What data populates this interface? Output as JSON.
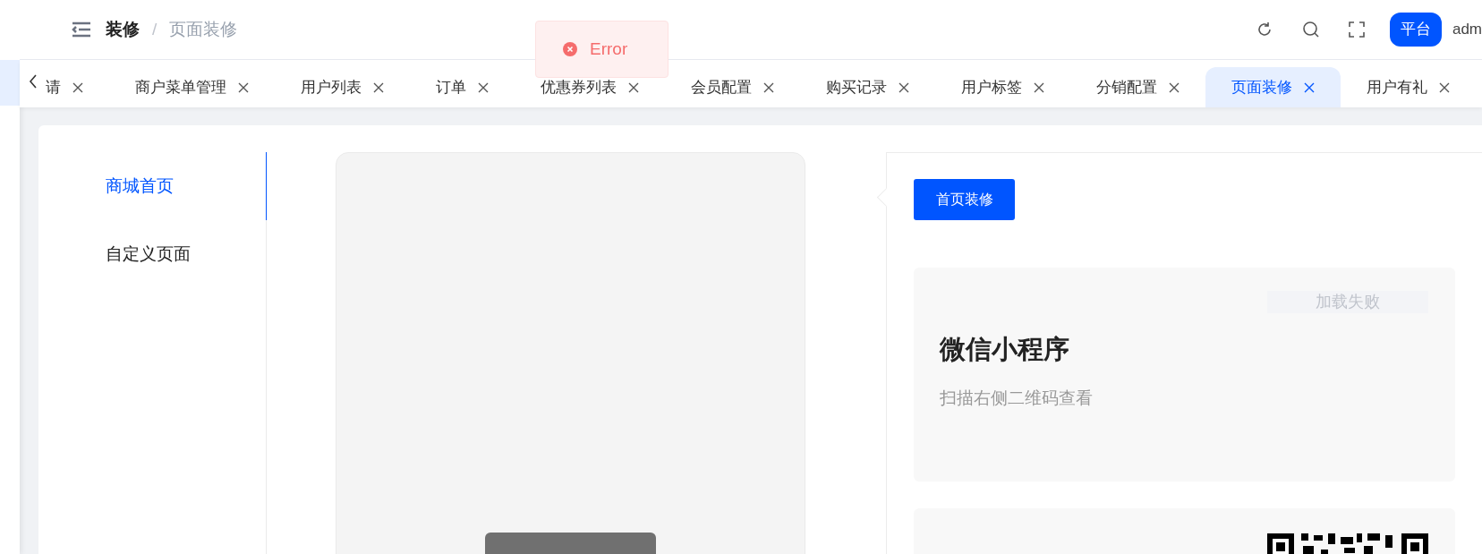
{
  "header": {
    "breadcrumb": [
      {
        "label": "装修",
        "selected": false
      },
      {
        "label": "页面装修",
        "selected": true
      }
    ],
    "separator": "/",
    "platform_button": "平台",
    "user": "adm"
  },
  "toast": {
    "kind": "error",
    "message": "Error"
  },
  "tabs": [
    {
      "label": "请",
      "selected": false
    },
    {
      "label": "商户菜单管理",
      "selected": false
    },
    {
      "label": "用户列表",
      "selected": false
    },
    {
      "label": "订单",
      "selected": false
    },
    {
      "label": "优惠券列表",
      "selected": false
    },
    {
      "label": "会员配置",
      "selected": false
    },
    {
      "label": "购买记录",
      "selected": false
    },
    {
      "label": "用户标签",
      "selected": false
    },
    {
      "label": "分销配置",
      "selected": false
    },
    {
      "label": "页面装修",
      "selected": true
    },
    {
      "label": "用户有礼",
      "selected": false
    }
  ],
  "side_menu": [
    {
      "label": "商城首页",
      "selected": true
    },
    {
      "label": "自定义页面",
      "selected": false
    }
  ],
  "panel": {
    "button": "首页装修",
    "card": {
      "image_status": "加载失败",
      "title": "微信小程序",
      "subtitle": "扫描右侧二维码查看"
    }
  }
}
